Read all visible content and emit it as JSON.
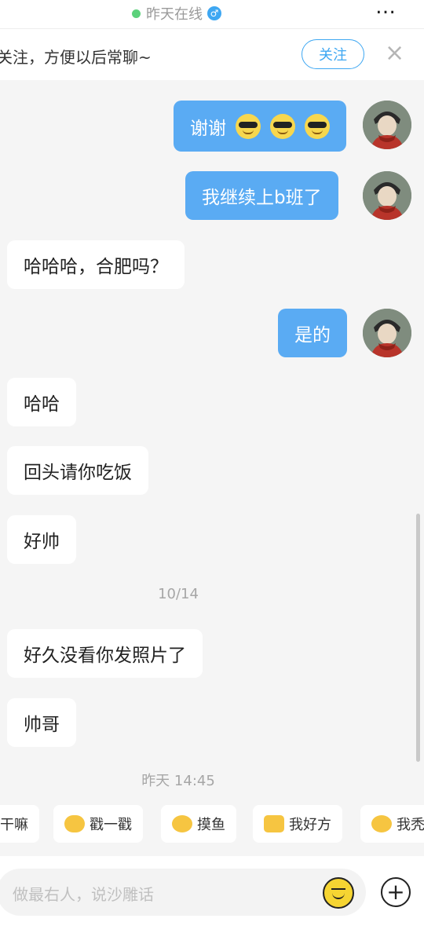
{
  "header": {
    "online_status": "昨天在线",
    "gender_symbol": "♂",
    "more_symbol": "…"
  },
  "follow_bar": {
    "text": "关注，方便以后常聊~",
    "follow_label": "关注",
    "close_symbol": "×"
  },
  "messages": [
    {
      "from": "me",
      "text": "谢谢",
      "emoji_count": 3
    },
    {
      "from": "me",
      "text": "我继续上b班了"
    },
    {
      "from": "them",
      "text": "哈哈哈，合肥吗？"
    },
    {
      "from": "me",
      "text": "是的"
    },
    {
      "from": "them",
      "text": "哈哈"
    },
    {
      "from": "them",
      "text": "回头请你吃饭"
    },
    {
      "from": "them",
      "text": "好帅"
    },
    {
      "from": "them",
      "text": "好久没看你发照片了"
    },
    {
      "from": "them",
      "text": "帅哥"
    }
  ],
  "timestamps": [
    "10/14",
    "昨天 14:45"
  ],
  "quick_replies": [
    "干嘛",
    "戳一戳",
    "摸鱼",
    "我好方",
    "我秃"
  ],
  "input": {
    "placeholder": "做最右人，说沙雕话",
    "plus_symbol": "+"
  },
  "colors": {
    "accent": "#3ea7f2",
    "my_bubble": "#5aabf3",
    "their_bubble": "#ffffff",
    "background": "#f5f5f5",
    "online_dot": "#5cd17b"
  }
}
